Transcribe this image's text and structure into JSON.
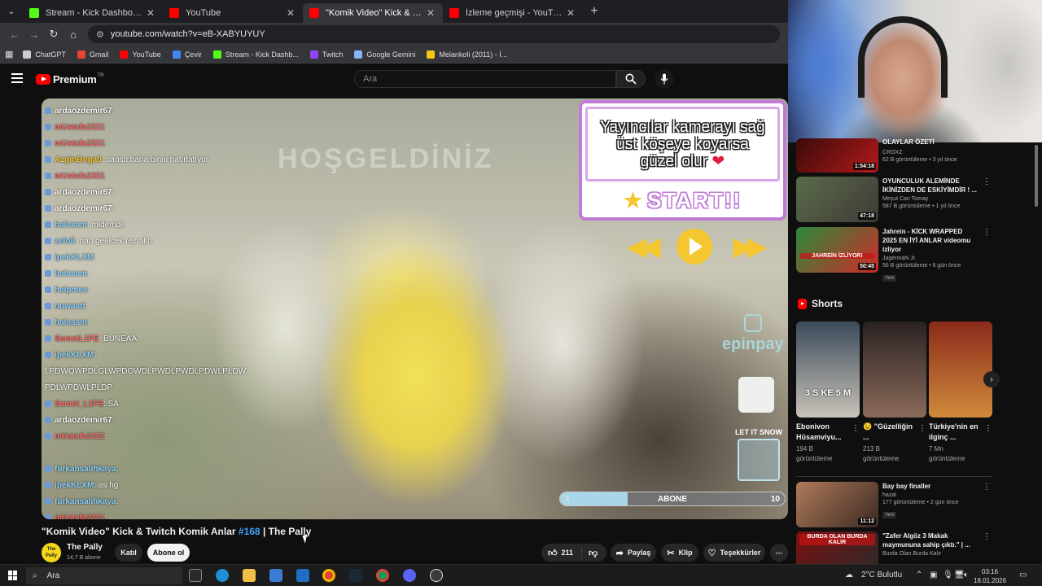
{
  "browser": {
    "tabs": [
      {
        "title": "Stream - Kick Dashboard",
        "color": "#53fc18"
      },
      {
        "title": "YouTube",
        "color": "#ff0000"
      },
      {
        "title": "\"Komik Video\" Kick & Twitch Ko",
        "color": "#ff0000"
      },
      {
        "title": "İzleme geçmişi - YouTube",
        "color": "#ff0000"
      }
    ],
    "url": "youtube.com/watch?v=eB-XABYUYUY",
    "bookmarks": [
      {
        "label": "ChatGPT",
        "color": "#cccccc"
      },
      {
        "label": "Gmail",
        "color": "#ea4335"
      },
      {
        "label": "YouTube",
        "color": "#ff0000"
      },
      {
        "label": "Çevir",
        "color": "#4285f4"
      },
      {
        "label": "Stream - Kick Dashb...",
        "color": "#53fc18"
      },
      {
        "label": "Twitch",
        "color": "#9146ff"
      },
      {
        "label": "Google Gemini",
        "color": "#8ab4f8"
      },
      {
        "label": "Melankoli (2011) - İ...",
        "color": "#f5c518"
      }
    ]
  },
  "youtube": {
    "logo_text": "Premium",
    "logo_country": "TR",
    "search_placeholder": "Ara"
  },
  "stream": {
    "welcome": "HOŞGELDİNİZ",
    "chat": [
      {
        "user": "ardaozdemir67",
        "msg": ":",
        "color": "#ffffff"
      },
      {
        "user": "mUstafa2321",
        "msg": ":",
        "color": "#ff6b6b"
      },
      {
        "user": "mUstafa2321",
        "msg": ":",
        "color": "#ff6b6b"
      },
      {
        "user": "AzginBoga0",
        "msg": ": cansu bana birini hatırlatıyor",
        "color": "#f4c630"
      },
      {
        "user": "mUstafa2321",
        "msg": ":",
        "color": "#ff6b6b"
      },
      {
        "user": "ardaozdemir67",
        "msg": ":",
        "color": "#ffffff"
      },
      {
        "user": "ardaozdemir67",
        "msg": ":",
        "color": "#ffffff"
      },
      {
        "user": "balssam",
        "msg": ": midemde",
        "color": "#8bd3ff"
      },
      {
        "user": "zeloli",
        "msg": ": nah geelcek rez alin",
        "color": "#8bd3ff"
      },
      {
        "user": "ipekKLXM",
        "msg": ":",
        "color": "#8bd3ff"
      },
      {
        "user": "balssam",
        "msg": ":",
        "color": "#8bd3ff"
      },
      {
        "user": "helpmee",
        "msg": ":",
        "color": "#8bd3ff"
      },
      {
        "user": "nuwaatt",
        "msg": ":",
        "color": "#8bd3ff"
      },
      {
        "user": "balssam",
        "msg": ":",
        "color": "#8bd3ff"
      },
      {
        "user": "SametL1FE",
        "msg": ": BUNEAA",
        "color": "#ff6b6b"
      },
      {
        "user": "ipekKLXM",
        "msg": ":",
        "color": "#8bd3ff"
      },
      {
        "user": "",
        "msg": "LPDWQWPDLGLWPDGWDLPWDLPWDLPDWLPLDW",
        "color": "#ffffff"
      },
      {
        "user": "",
        "msg": "PDLWPDWLPLDP",
        "color": "#ffffff"
      },
      {
        "user": "Samet_L1FE",
        "msg": ": SA",
        "color": "#ff6b6b"
      },
      {
        "user": "ardaozdemir67",
        "msg": ":",
        "color": "#ffffff"
      },
      {
        "user": "mUstafa2321",
        "msg": ":",
        "color": "#ff6b6b"
      },
      {
        "user": "",
        "msg": "",
        "color": "#ffffff"
      },
      {
        "user": "furkansalihkaya",
        "msg": ":",
        "color": "#8bd3ff"
      },
      {
        "user": "ipekKLXM",
        "msg": ": as hg",
        "color": "#8bd3ff"
      },
      {
        "user": "furkansalihkaya",
        "msg": ":",
        "color": "#8bd3ff"
      },
      {
        "user": "mUstafa2321",
        "msg": ":",
        "color": "#ff6b6b"
      }
    ],
    "overlay_text": "Yayıncılar kamerayı sağ üst köşeye koyarsa güzel olur",
    "start_text": "START!!",
    "sponsor": "epinpay",
    "snow": "LET IT SNOW",
    "goal": {
      "current": "3",
      "label": "ABONE",
      "target": "10",
      "progress": 0.3
    }
  },
  "video": {
    "title": "\"Komik Video\" Kick & Twitch Komik Anlar",
    "tag": "#168",
    "title_suffix": "| The Pally",
    "channel": "The Pally",
    "subs": "14,7 B abone",
    "avatar_text": "The Pally",
    "join": "Katıl",
    "subscribe": "Abone ol",
    "likes": "211",
    "share": "Paylaş",
    "clip": "Klip",
    "thanks": "Teşekkürler"
  },
  "sidebar": {
    "partial_title": "OLAYLAR ÖZETİ",
    "videos": [
      {
        "title": "",
        "channel": "CROXZ",
        "stats": "62 B görüntüleme • 3 yıl önce",
        "duration": "1:54:18",
        "colors": [
          "#3a0a0a",
          "#b41a1a"
        ]
      },
      {
        "title": "OYUNCULUK ALEMİNDE İKİNİZDEN DE ESKİYİMDİR ! ...",
        "channel": "Meşut Can Tomay",
        "stats": "587 B görüntüleme • 1 yıl önce",
        "duration": "47:18",
        "colors": [
          "#5a6b4a",
          "#3f3a36"
        ]
      },
      {
        "title": "Jahrein - KİCK WRAPPED 2025 EN İYİ ANLAR videomu izliyor",
        "channel": "JagermaN Jr.",
        "stats": "56 B görüntüleme • 6 gün önce",
        "duration": "50:45",
        "badge": "Yeni",
        "colors": [
          "#2a8a3a",
          "#d02a2a"
        ],
        "thumb_text": "JAHREİN İZLİYOR!"
      },
      {
        "title": "Bay bay finaller",
        "channel": "hazal",
        "stats": "177 görüntüleme • 2 gün önce",
        "duration": "11:12",
        "badge": "Yeni",
        "colors": [
          "#b07a5a",
          "#3a2a22"
        ]
      },
      {
        "title": "\"Zafer Algöz 3 Makak maymununa sahip çıktı.\" | ...",
        "channel": "Burda Olan Burda Kalır",
        "stats": "",
        "duration": "",
        "colors": [
          "#7a1010",
          "#2a2a2a"
        ],
        "thumb_text": "BURDA OLAN BURDA KALIR"
      }
    ],
    "shorts_title": "Shorts",
    "shorts": [
      {
        "title": "Ebonivon Hüsamviyu...",
        "views": "194 B görüntüleme",
        "thumb_text": "3 S KE 5 M",
        "colors": [
          "#3a4a5a",
          "#c9c2b8"
        ]
      },
      {
        "title": "😉 \"Güzelliğin ...",
        "views": "213 B görüntüleme",
        "colors": [
          "#2a2222",
          "#8a6a5a"
        ]
      },
      {
        "title": "Türkiye'nin en ilginç ...",
        "views": "7 Mn görüntüleme",
        "colors": [
          "#8a2a1a",
          "#d08a3a"
        ]
      }
    ]
  },
  "taskbar": {
    "search": "Ara",
    "weather": "2°C  Bulutlu",
    "time": "03:16",
    "date": "18.01.2026"
  }
}
